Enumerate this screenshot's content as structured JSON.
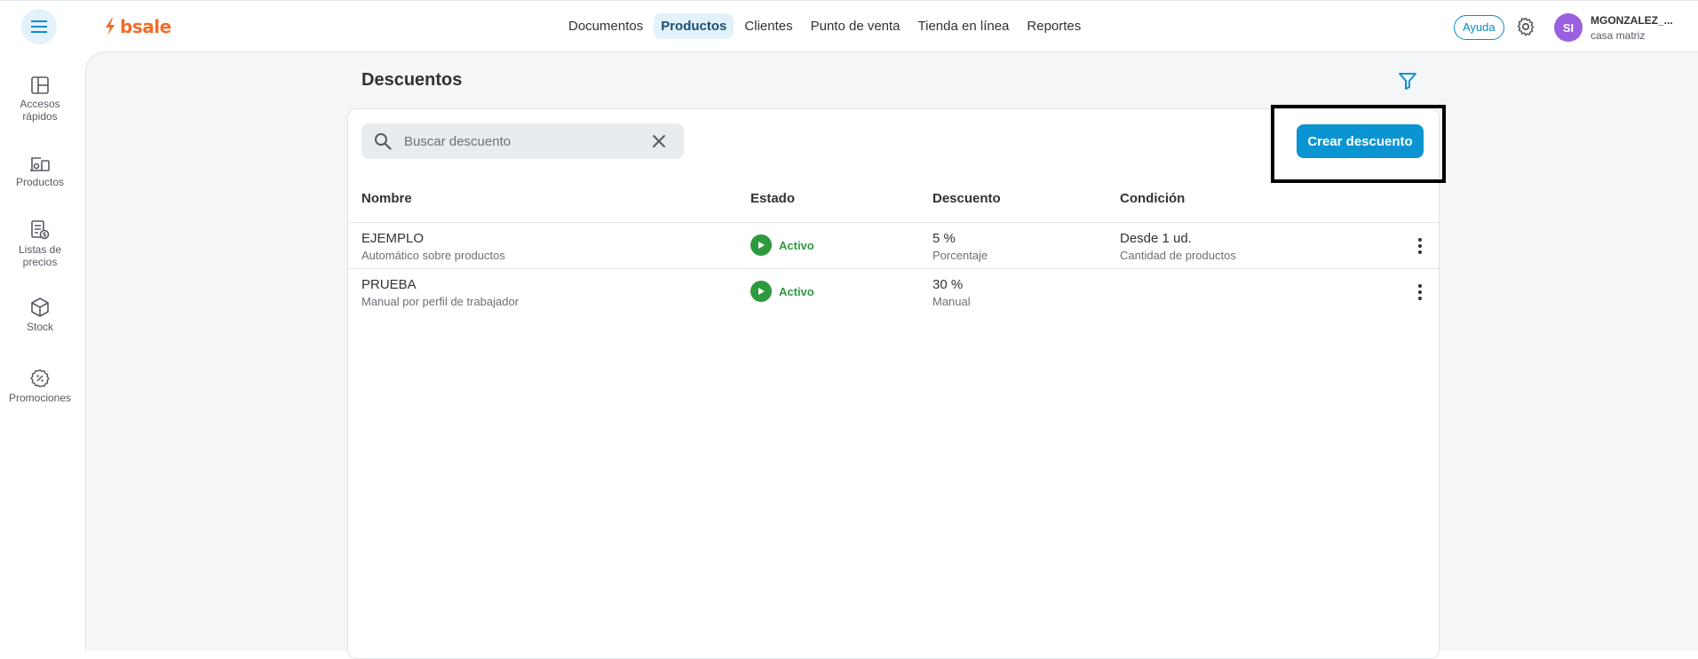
{
  "brand": {
    "logo_text": "bsale",
    "accent": "#f26b2a"
  },
  "nav": {
    "items": [
      {
        "label": "Documentos"
      },
      {
        "label": "Productos",
        "active": true
      },
      {
        "label": "Clientes"
      },
      {
        "label": "Punto de venta"
      },
      {
        "label": "Tienda en línea"
      },
      {
        "label": "Reportes"
      }
    ]
  },
  "header": {
    "help_label": "Ayuda",
    "avatar_initials": "SI",
    "user_name": "MGONZALEZ_...",
    "user_branch": "casa matriz"
  },
  "sidebar": {
    "items": [
      {
        "label_line1": "Accesos",
        "label_line2": "rápidos",
        "icon": "quick-access-icon"
      },
      {
        "label_line1": "Productos",
        "label_line2": "",
        "icon": "products-icon"
      },
      {
        "label_line1": "Listas de",
        "label_line2": "precios",
        "icon": "price-list-icon"
      },
      {
        "label_line1": "Stock",
        "label_line2": "",
        "icon": "stock-box-icon"
      },
      {
        "label_line1": "Promociones",
        "label_line2": "",
        "icon": "promotions-icon"
      }
    ]
  },
  "page": {
    "title": "Descuentos",
    "search_placeholder": "Buscar descuento",
    "create_label": "Crear descuento"
  },
  "table": {
    "headers": [
      "Nombre",
      "Estado",
      "Descuento",
      "Condición"
    ],
    "rows": [
      {
        "name": "EJEMPLO",
        "name_sub": "Automático sobre productos",
        "status": "Activo",
        "discount": "5 %",
        "discount_sub": "Porcentaje",
        "condition": "Desde 1 ud.",
        "condition_sub": "Cantidad de productos"
      },
      {
        "name": "PRUEBA",
        "name_sub": "Manual por perfil de trabajador",
        "status": "Activo",
        "discount": "30 %",
        "discount_sub": "Manual",
        "condition": "",
        "condition_sub": ""
      }
    ]
  },
  "colors": {
    "primary": "#0b94d2",
    "active_status": "#2e9a3e",
    "avatar": "#9b5fe0"
  }
}
